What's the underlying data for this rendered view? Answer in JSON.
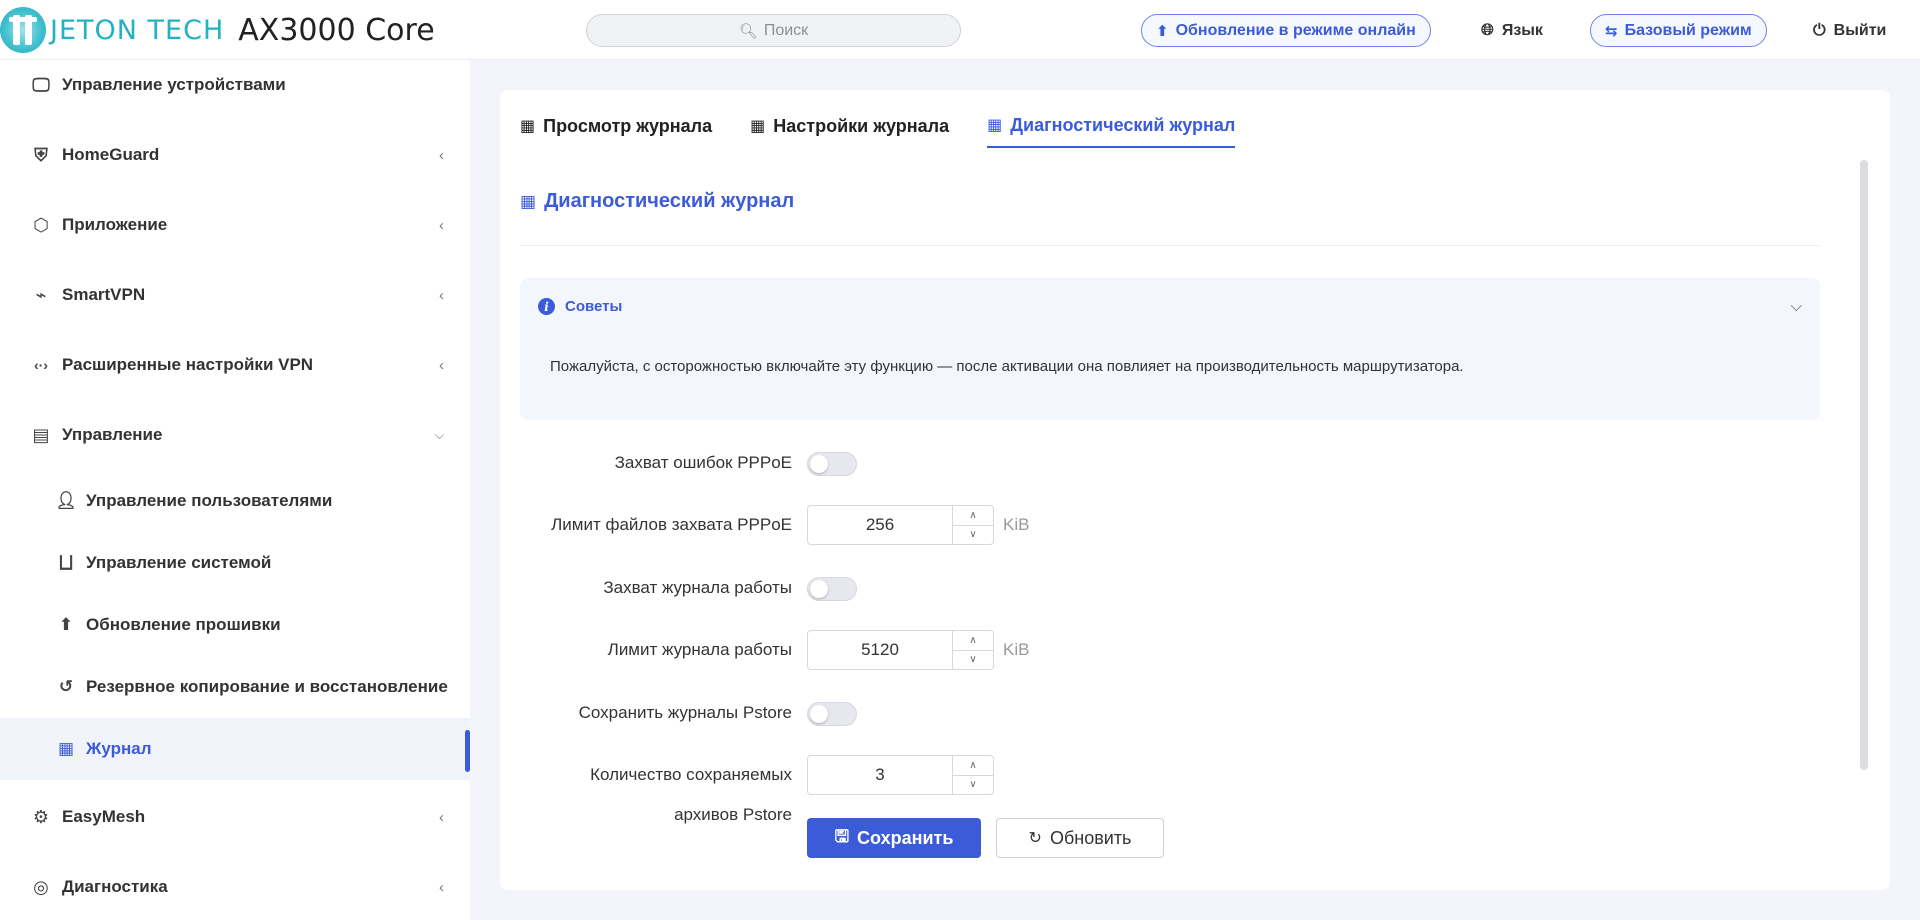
{
  "header": {
    "brand": "JETON TECH",
    "model": "AX3000 Core",
    "search_placeholder": "Поиск",
    "online_update": "Обновление в режиме онлайн",
    "language": "Язык",
    "basic_mode": "Базовый режим",
    "logout": "Выйти"
  },
  "sidebar": {
    "items": [
      {
        "label": "Управление устройствами",
        "icon": "monitor-icon"
      },
      {
        "label": "HomeGuard",
        "icon": "shield-icon"
      },
      {
        "label": "Приложение",
        "icon": "cube-icon"
      },
      {
        "label": "SmartVPN",
        "icon": "plug-icon"
      },
      {
        "label": "Расширенные настройки VPN",
        "icon": "code-arrows-icon"
      },
      {
        "label": "Управление",
        "icon": "toolbox-icon"
      },
      {
        "label": "EasyMesh",
        "icon": "gear-icon"
      },
      {
        "label": "Диагностика",
        "icon": "radar-icon"
      }
    ],
    "sub_items": [
      {
        "label": "Управление пользователями",
        "icon": "user-icon"
      },
      {
        "label": "Управление системой",
        "icon": "router-icon"
      },
      {
        "label": "Обновление прошивки",
        "icon": "upload-circle-icon"
      },
      {
        "label": "Резервное копирование и восстановление",
        "icon": "restore-icon"
      },
      {
        "label": "Журнал",
        "icon": "log-icon"
      }
    ]
  },
  "tabs": [
    {
      "label": "Просмотр журнала"
    },
    {
      "label": "Настройки журнала"
    },
    {
      "label": "Диагностический журнал"
    }
  ],
  "section": {
    "title": "Диагностический журнал"
  },
  "tips": {
    "title": "Советы",
    "text": "Пожалуйста, с осторожностью включайте эту функцию — после активации она повлияет на производительность маршрутизатора."
  },
  "form": {
    "pppoe_capture_label": "Захват ошибок PPPoE",
    "pppoe_limit_label": "Лимит файлов захвата PPPoE",
    "pppoe_limit_value": "256",
    "pppoe_limit_unit": "KiB",
    "worklog_capture_label": "Захват журнала работы",
    "worklog_limit_label": "Лимит журнала работы",
    "worklog_limit_value": "5120",
    "worklog_limit_unit": "KiB",
    "pstore_save_label": "Сохранить журналы Pstore",
    "pstore_count_label_1": "Количество сохраняемых",
    "pstore_count_label_2": "архивов Pstore",
    "pstore_count_value": "3",
    "save_label": "Сохранить",
    "refresh_label": "Обновить"
  },
  "colors": {
    "accent": "#3b5bd9",
    "brand": "#22b2c2"
  }
}
